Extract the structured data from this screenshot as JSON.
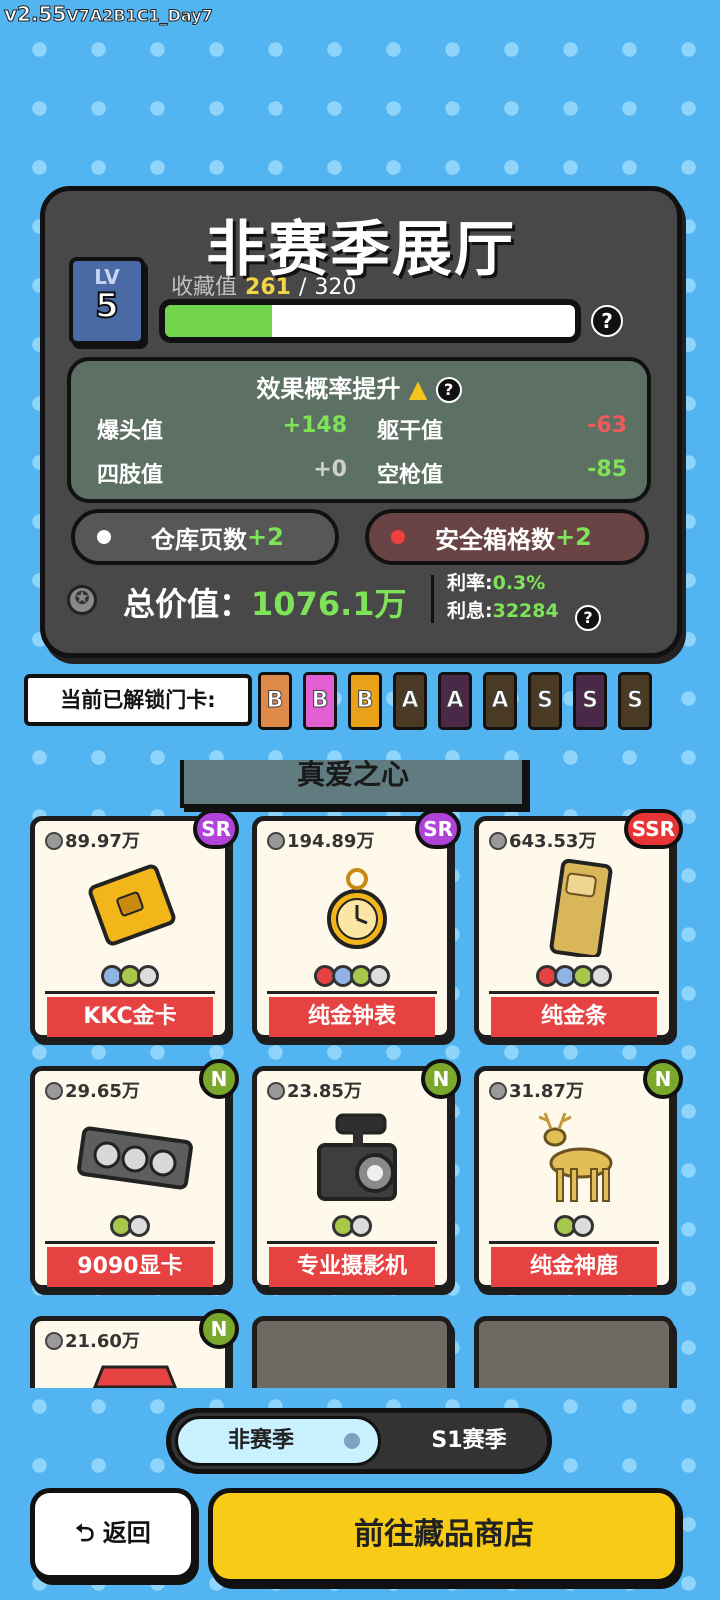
{
  "version": {
    "main": "v2.55",
    "suffix": "V7A2B1C1_Day7"
  },
  "hall": {
    "title": "非赛季展厅",
    "level_label": "LV",
    "level": "5",
    "collect_label": "收藏值",
    "collect_current": "261",
    "collect_sep": "/",
    "collect_max": "320",
    "progress_fraction": 0.26,
    "help": "?"
  },
  "effects": {
    "title": "效果概率提升",
    "stats": [
      {
        "label": "爆头值",
        "value": "+148",
        "color": "#7fe35a"
      },
      {
        "label": "躯干值",
        "value": "-63",
        "color": "#f05a5a"
      },
      {
        "label": "四肢值",
        "value": "+0",
        "color": "#cfcfcf"
      },
      {
        "label": "空枪值",
        "value": "-85",
        "color": "#7fe35a"
      }
    ]
  },
  "buttons": {
    "warehouse": "仓库页数",
    "warehouse_plus": "+2",
    "safebox": "安全箱格数",
    "safebox_plus": "+2",
    "back": "返回",
    "shop": "前往藏品商店"
  },
  "totals": {
    "label": "总价值：",
    "value": "1076.1万",
    "rate_label": "利率:",
    "rate": "0.3%",
    "interest_label": "利息:",
    "interest": "32284"
  },
  "keycards": {
    "label": "当前已解锁门卡:",
    "cards": [
      {
        "letter": "B",
        "color": "#e08a4a"
      },
      {
        "letter": "B",
        "color": "#e25ed2"
      },
      {
        "letter": "B",
        "color": "#e8a21a"
      },
      {
        "letter": "A",
        "color": "#4a3a24"
      },
      {
        "letter": "A",
        "color": "#4a2848"
      },
      {
        "letter": "A",
        "color": "#4a3a24"
      },
      {
        "letter": "S",
        "color": "#4a3a24"
      },
      {
        "letter": "S",
        "color": "#4a2848"
      },
      {
        "letter": "S",
        "color": "#4a3a24"
      }
    ]
  },
  "section": {
    "title": "真爱之心"
  },
  "items": [
    {
      "price": "89.97万",
      "rarity": "SR",
      "rarity_color": "#b044d8",
      "name": "KKC金卡",
      "icon": "gold-card-icon"
    },
    {
      "price": "194.89万",
      "rarity": "SR",
      "rarity_color": "#b044d8",
      "name": "纯金钟表",
      "icon": "gold-pocket-watch-icon"
    },
    {
      "price": "643.53万",
      "rarity": "SSR",
      "rarity_color": "#e83434",
      "name": "纯金条",
      "icon": "gold-bar-icon"
    },
    {
      "price": "29.65万",
      "rarity": "N",
      "rarity_color": "#7aa82a",
      "name": "9090显卡",
      "icon": "graphics-card-icon"
    },
    {
      "price": "23.85万",
      "rarity": "N",
      "rarity_color": "#7aa82a",
      "name": "专业摄影机",
      "icon": "video-camera-icon"
    },
    {
      "price": "31.87万",
      "rarity": "N",
      "rarity_color": "#7aa82a",
      "name": "纯金神鹿",
      "icon": "gold-deer-icon"
    },
    {
      "price": "21.60万",
      "rarity": "N",
      "rarity_color": "#7aa82a",
      "name": "",
      "icon": "item-icon"
    }
  ],
  "season_toggle": {
    "option_a": "非赛季",
    "option_b": "S1赛季"
  }
}
